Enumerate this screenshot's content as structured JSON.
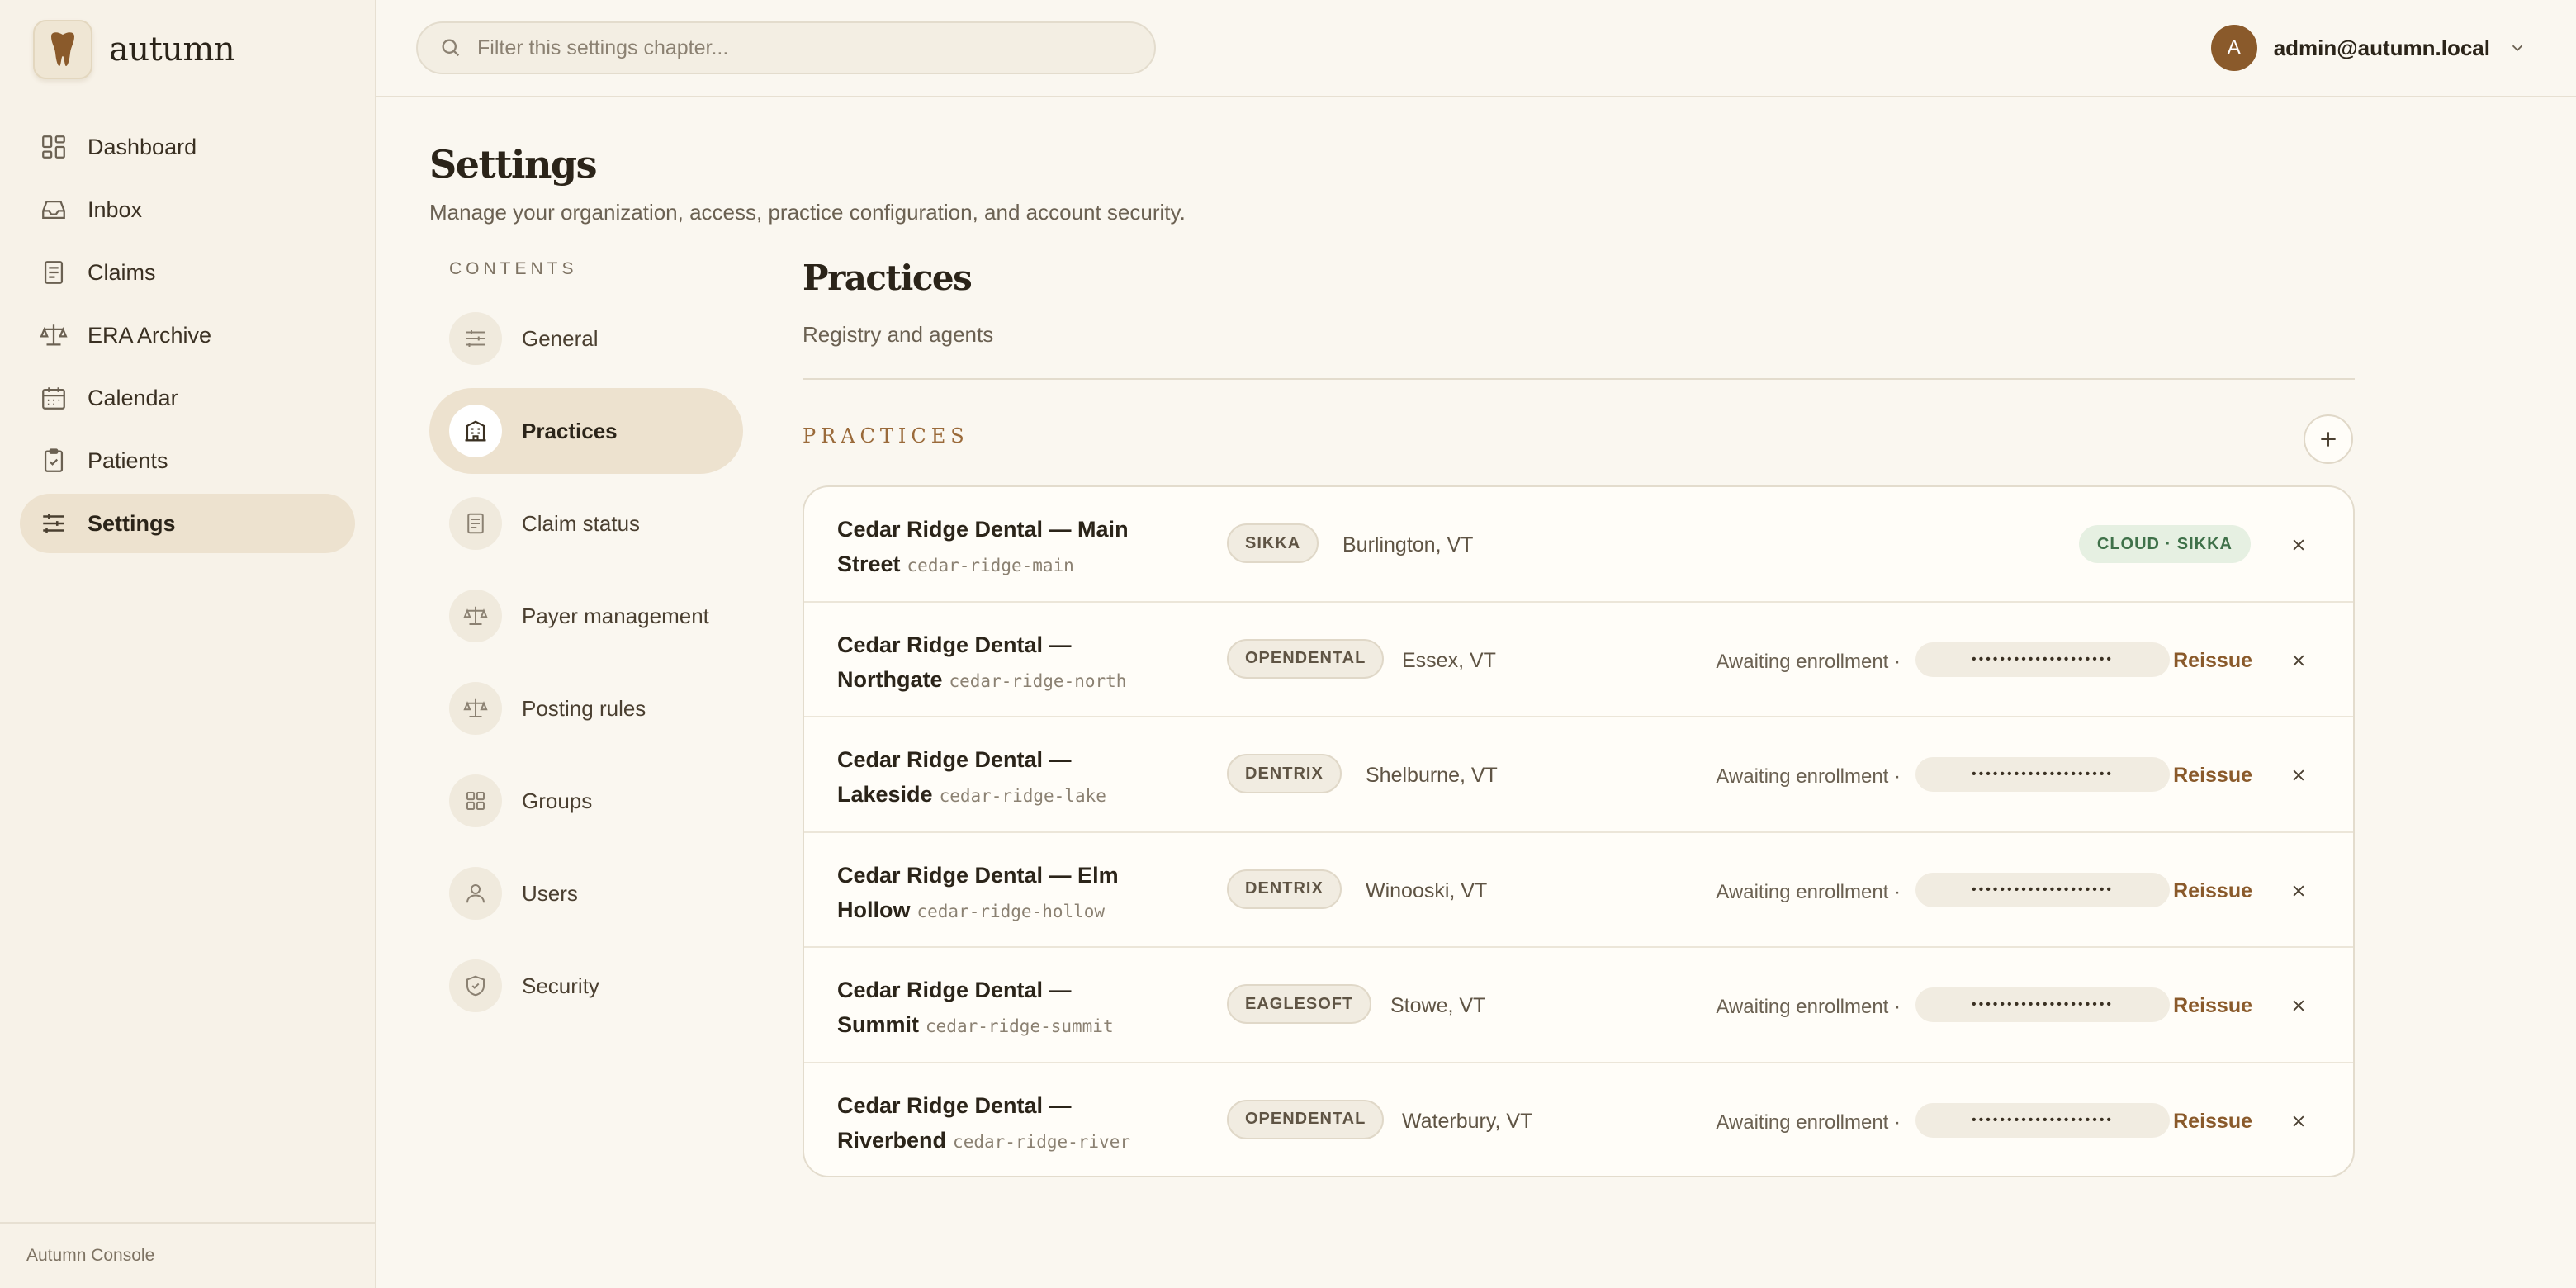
{
  "app": {
    "name": "autumn",
    "footer": "Autumn Console"
  },
  "sidebar": {
    "items": [
      {
        "label": "Dashboard",
        "icon": "grid-icon"
      },
      {
        "label": "Inbox",
        "icon": "inbox-icon"
      },
      {
        "label": "Claims",
        "icon": "document-icon"
      },
      {
        "label": "ERA Archive",
        "icon": "scale-icon"
      },
      {
        "label": "Calendar",
        "icon": "calendar-icon"
      },
      {
        "label": "Patients",
        "icon": "clipboard-icon"
      },
      {
        "label": "Settings",
        "icon": "sliders-icon",
        "active": true
      }
    ]
  },
  "search": {
    "placeholder": "Filter this settings chapter..."
  },
  "user": {
    "initial": "A",
    "email": "admin@autumn.local"
  },
  "page": {
    "title": "Settings",
    "subtitle": "Manage your organization, access, practice configuration, and account security."
  },
  "contents": {
    "heading": "CONTENTS",
    "items": [
      {
        "label": "General",
        "icon": "sliders-icon"
      },
      {
        "label": "Practices",
        "icon": "building-icon",
        "active": true
      },
      {
        "label": "Claim status",
        "icon": "document-icon"
      },
      {
        "label": "Payer management",
        "icon": "scale-icon"
      },
      {
        "label": "Posting rules",
        "icon": "scale-icon"
      },
      {
        "label": "Groups",
        "icon": "grid-icon"
      },
      {
        "label": "Users",
        "icon": "user-icon"
      },
      {
        "label": "Security",
        "icon": "shield-icon"
      }
    ]
  },
  "section": {
    "title": "Practices",
    "subtitle": "Registry and agents",
    "list_heading": "PRACTICES"
  },
  "practices": [
    {
      "name": "Cedar Ridge Dental — Main Street",
      "slug": "cedar-ridge-main",
      "pms": "SIKKA",
      "location": "Burlington, VT",
      "status": "CLOUD · SIKKA"
    },
    {
      "name": "Cedar Ridge Dental — Northgate",
      "slug": "cedar-ridge-north",
      "pms": "OPENDENTAL",
      "location": "Essex, VT",
      "status": "Awaiting enrollment ·",
      "token": "••••••••••••••••••••",
      "action": "Reissue"
    },
    {
      "name": "Cedar Ridge Dental — Lakeside",
      "slug": "cedar-ridge-lake",
      "pms": "DENTRIX",
      "location": "Shelburne, VT",
      "status": "Awaiting enrollment ·",
      "token": "••••••••••••••••••••",
      "action": "Reissue"
    },
    {
      "name": "Cedar Ridge Dental — Elm Hollow",
      "slug": "cedar-ridge-hollow",
      "pms": "DENTRIX",
      "location": "Winooski, VT",
      "status": "Awaiting enrollment ·",
      "token": "••••••••••••••••••••",
      "action": "Reissue"
    },
    {
      "name": "Cedar Ridge Dental — Summit",
      "slug": "cedar-ridge-summit",
      "pms": "EAGLESOFT",
      "location": "Stowe, VT",
      "status": "Awaiting enrollment ·",
      "token": "••••••••••••••••••••",
      "action": "Reissue"
    },
    {
      "name": "Cedar Ridge Dental — Riverbend",
      "slug": "cedar-ridge-river",
      "pms": "OPENDENTAL",
      "location": "Waterbury, VT",
      "status": "Awaiting enrollment ·",
      "token": "••••••••••••••••••••",
      "action": "Reissue"
    }
  ],
  "colors": {
    "accent": "#8a5a2b",
    "background": "#faf7f0",
    "active": "#ede2cf",
    "success": "#3f7149"
  }
}
